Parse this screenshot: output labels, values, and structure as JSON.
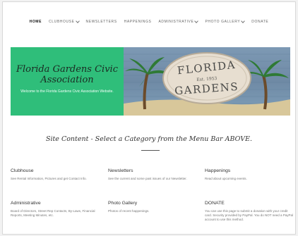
{
  "nav": {
    "items": [
      {
        "label": "HOME",
        "active": true,
        "dropdown": false
      },
      {
        "label": "CLUBHOUSE",
        "active": false,
        "dropdown": true
      },
      {
        "label": "NEWSLETTERS",
        "active": false,
        "dropdown": false
      },
      {
        "label": "HAPPENINGS",
        "active": false,
        "dropdown": false
      },
      {
        "label": "ADMINISTRATIVE",
        "active": false,
        "dropdown": true
      },
      {
        "label": "PHOTO GALLERY",
        "active": false,
        "dropdown": true
      },
      {
        "label": "DONATE",
        "active": false,
        "dropdown": false
      }
    ]
  },
  "hero": {
    "title": "Florida Gardens Civic Association",
    "subtitle": "Welcome to the Florida Gardens Civic Association Website.",
    "sign": {
      "line1": "FLORIDA",
      "est": "Est. 1953",
      "line2": "GARDENS"
    },
    "accent_color": "#2fbe7a"
  },
  "headline": "Site Content - Select a Category from the Menu Bar ABOVE.",
  "cards": [
    {
      "title": "Clubhouse",
      "text": "See Rental Information, Pictures and get Contact Info."
    },
    {
      "title": "Newsletters",
      "text": "See the current and some past issues of our Newsletter."
    },
    {
      "title": "Happenings",
      "text": "Read about upcoming events."
    },
    {
      "title": "Administrative",
      "text": "Board of Directors, Street Rep Contacts, By-Laws, Financial Reports, Meeting Minutes, etc."
    },
    {
      "title": "Photo Gallery",
      "text": "Photos of recent happenings."
    },
    {
      "title": "DONATE",
      "text": "You can use this page to submit a donation with your credit card. Security provided by PayPal. You do NOT need a PayPal account to use this method."
    }
  ]
}
